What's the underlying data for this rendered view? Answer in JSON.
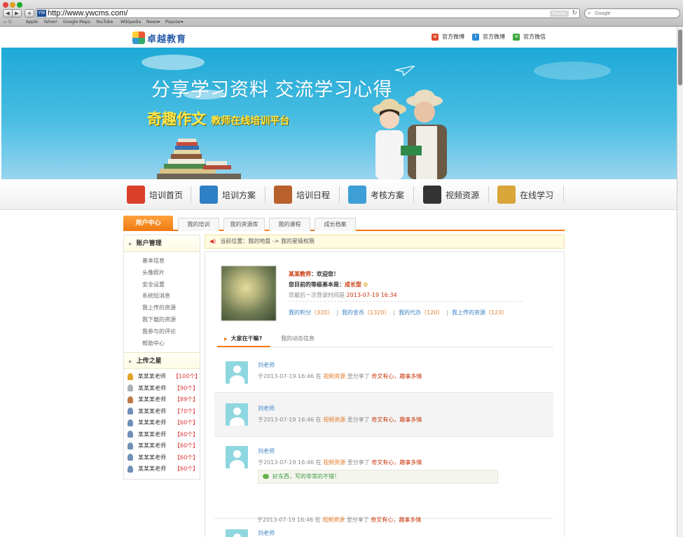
{
  "browser": {
    "url": "http://www.ywcms.com/",
    "favicon_text": "YW",
    "reader_label": "Reader",
    "search_placeholder": "Google",
    "bookmarks": [
      "Apple",
      "Yahoo!",
      "Google Maps",
      "YouTube",
      "Wikipedia",
      "News▾",
      "Popular▾"
    ]
  },
  "header": {
    "logo_text": "卓越教育",
    "social": [
      {
        "label": "官方微博",
        "icon": "weibo-icon",
        "color": "#e04a2a"
      },
      {
        "label": "官方微博",
        "icon": "tencent-weibo-icon",
        "color": "#2a8ad6"
      },
      {
        "label": "官方微信",
        "icon": "wechat-icon",
        "color": "#3aa63a"
      }
    ]
  },
  "banner": {
    "headline": "分享学习资料  交流学习心得",
    "subtitle_main": "奇趣作文",
    "subtitle_small": "教师在线培训平台"
  },
  "nav": {
    "items": [
      {
        "label": "培训首页",
        "icon": "home-icon",
        "color": "#d9402a"
      },
      {
        "label": "培训方案",
        "icon": "address-book-icon",
        "color": "#2f7fc6"
      },
      {
        "label": "培训日程",
        "icon": "planner-icon",
        "color": "#b8612c"
      },
      {
        "label": "考核方案",
        "icon": "puzzle-icon",
        "color": "#3e9fd6"
      },
      {
        "label": "视频资源",
        "icon": "clapperboard-icon",
        "color": "#333333"
      },
      {
        "label": "在线学习",
        "icon": "notepad-pen-icon",
        "color": "#d9a63a"
      }
    ]
  },
  "subnav": {
    "active": "用户中心",
    "tabs": [
      "我的培训",
      "我的资源库",
      "我的课程",
      "成长档案"
    ]
  },
  "sidebar": {
    "account_title": "账户管理",
    "account_links": [
      "基本信息",
      "头像照片",
      "安全设置",
      "系统短消息",
      "我上传的资源",
      "我下载的资源",
      "我参与的评论",
      "帮助中心"
    ],
    "stars_title": "上传之星",
    "stars": [
      {
        "name": "某某某老师",
        "count": "【100个】",
        "medal_color": "#e0a52a"
      },
      {
        "name": "某某某老师",
        "count": "【90个】",
        "medal_color": "#a9b0b8"
      },
      {
        "name": "某某某老师",
        "count": "【89个】",
        "medal_color": "#c07a4a"
      },
      {
        "name": "某某某老师",
        "count": "【70个】",
        "medal_color": "#6f8fb8"
      },
      {
        "name": "某某某老师",
        "count": "【60个】",
        "medal_color": "#6f8fb8"
      },
      {
        "name": "某某某老师",
        "count": "【60个】",
        "medal_color": "#6f8fb8"
      },
      {
        "name": "某某某老师",
        "count": "【60个】",
        "medal_color": "#6f8fb8"
      },
      {
        "name": "某某某老师",
        "count": "【60个】",
        "medal_color": "#6f8fb8"
      },
      {
        "name": "某某某老师",
        "count": "【60个】",
        "medal_color": "#6f8fb8"
      }
    ]
  },
  "breadcrumb": {
    "text": "当前位置：我的地盘 -> 我的星级权限"
  },
  "profile": {
    "name": "某某教师",
    "welcome": "：欢迎您！",
    "level_prefix": "您目前的等级基本是：",
    "level": "成长型",
    "login_prefix": "您最后一次登录时间是",
    "login_time": "2013-07-19 16:34",
    "stats": [
      {
        "label": "我的积分",
        "value": "（320）"
      },
      {
        "label": "我的金币",
        "value": "（1320）"
      },
      {
        "label": "我的代办",
        "value": "（120）"
      },
      {
        "label": "我上传的资源",
        "value": "（123）"
      }
    ]
  },
  "feed": {
    "tab_active": "大家在干嘛?",
    "tab_other": "我的动态信息",
    "items": [
      {
        "name": "刘老师",
        "prefix": "于2013-07-19 16:46 在",
        "category": "视频资源",
        "action": "里分享了",
        "title": "奇文有心，趣事多情",
        "comment": ""
      },
      {
        "name": "刘老师",
        "prefix": "于2013-07-19 16:46 在",
        "category": "视频资源",
        "action": "里分享了",
        "title": "奇文有心，趣事多情",
        "comment": ""
      },
      {
        "name": "刘老师",
        "prefix": "于2013-07-19 16:46 在",
        "category": "视频资源",
        "action": "里分享了",
        "title": "奇文有心，趣事多情",
        "comment": "好东西，写的非常的不错！"
      },
      {
        "name": "刘老师",
        "prefix": "于2013-07-19 16:46 在",
        "category": "视频资源",
        "action": "里分享了",
        "title": "奇文有心，趣事多情",
        "comment": ""
      }
    ]
  },
  "colors": {
    "accent_orange": "#f07a12",
    "link_blue": "#3b82c4",
    "banner_blue": "#1da9d7"
  }
}
